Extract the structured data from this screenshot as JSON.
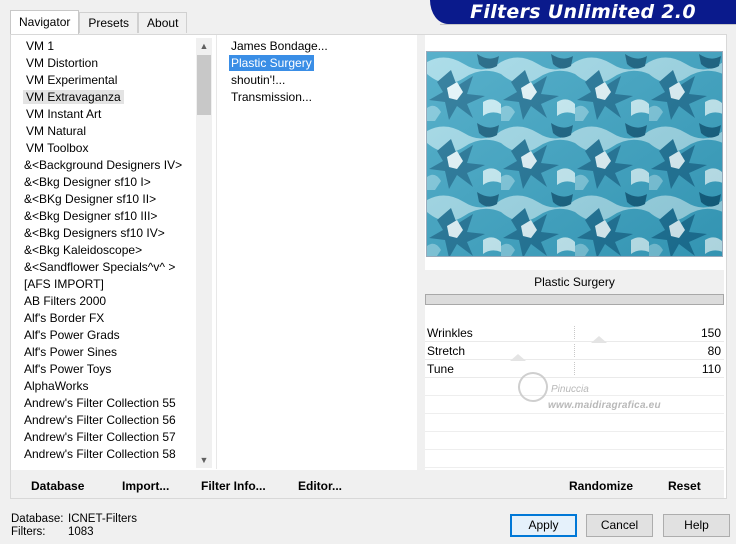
{
  "tabs": [
    "Navigator",
    "Presets",
    "About"
  ],
  "app_title": "Filters Unlimited 2.0",
  "categories": [
    "VM 1",
    "VM Distortion",
    "VM Experimental",
    "VM Extravaganza",
    "VM Instant Art",
    "VM Natural",
    "VM Toolbox",
    "&<Background Designers IV>",
    "&<Bkg Designer sf10 I>",
    "&<BKg Designer sf10 II>",
    "&<Bkg Designer sf10 III>",
    "&<Bkg Designers sf10 IV>",
    "&<Bkg Kaleidoscope>",
    "&<Sandflower Specials^v^ >",
    "[AFS IMPORT]",
    "AB Filters 2000",
    "Alf's Border FX",
    "Alf's Power Grads",
    "Alf's Power Sines",
    "Alf's Power Toys",
    "AlphaWorks",
    "Andrew's Filter Collection 55",
    "Andrew's Filter Collection 56",
    "Andrew's Filter Collection 57",
    "Andrew's Filter Collection 58"
  ],
  "selected_category": "VM Extravaganza",
  "filters": [
    "James Bondage...",
    "Plastic Surgery",
    "shoutin'!...",
    "Transmission..."
  ],
  "selected_filter": "Plastic Surgery",
  "preview_title": "Plastic Surgery",
  "params": [
    {
      "name": "Wrinkles",
      "value": "150"
    },
    {
      "name": "Stretch",
      "value": "80"
    },
    {
      "name": "Tune",
      "value": "110"
    }
  ],
  "watermark": {
    "name": "Pinuccia",
    "url": "www.maidiragrafica.eu"
  },
  "toolbar_left": {
    "database": "Database",
    "import": "Import...",
    "filter_info": "Filter Info...",
    "editor": "Editor..."
  },
  "toolbar_right": {
    "randomize": "Randomize",
    "reset": "Reset"
  },
  "footer": {
    "database_label": "Database:",
    "database_value": "ICNET-Filters",
    "filters_label": "Filters:",
    "filters_value": "1083"
  },
  "buttons": {
    "apply": "Apply",
    "cancel": "Cancel",
    "help": "Help"
  },
  "colors": {
    "banner": "#0a1a8c",
    "selection": "#3a8ee6",
    "preview_teal": "#2a9ab8"
  }
}
